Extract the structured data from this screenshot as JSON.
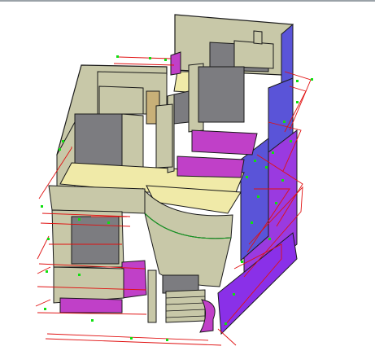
{
  "viewport": {
    "background": "#ffffff",
    "palette": {
      "wall": "#c8c8a8",
      "wall_dark": "#7c7c80",
      "floor": "#f0eaa8",
      "accent_purple": "#c040c8",
      "blue_wall": "#5a54d8",
      "door_wood": "#c8b078",
      "dimension_red": "#e01010",
      "grip_green": "#10e010",
      "edge": "#1a1a1a"
    }
  }
}
